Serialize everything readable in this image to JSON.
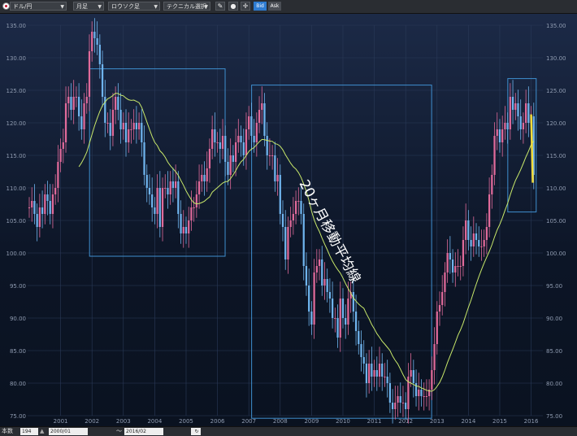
{
  "toolbar": {
    "pair_label": "ドル/円",
    "period_label": "月足",
    "chart_type_label": "ロウソク足",
    "indicator_label": "テクニカル選択",
    "bid_label": "Bid",
    "ask_label": "Ask"
  },
  "bottombar": {
    "count_label": "本数",
    "count_value": "194",
    "start_date": "2000/01",
    "range_sep": "〜",
    "end_date": "2016/02"
  },
  "colors": {
    "up_candle": "#e06a9a",
    "down_candle": "#6fb4ee",
    "ma_line": "#c8e86a",
    "highlight_line": "#f2dc3a",
    "box_border": "#3f8fcf",
    "grid": "#2a3a58"
  },
  "annotation": "20ヶ月移動平均線",
  "chart_data": {
    "type": "candlestick",
    "ylim": [
      75,
      135
    ],
    "yticks": [
      "135.00",
      "130.00",
      "125.00",
      "120.00",
      "115.00",
      "110.00",
      "105.00",
      "100.00",
      "95.00",
      "90.00",
      "85.00",
      "80.00",
      "75.00"
    ],
    "xticks": [
      "2001",
      "2002",
      "2003",
      "2004",
      "2005",
      "2006",
      "2007",
      "2008",
      "2009",
      "2010",
      "2011",
      "2012",
      "2013",
      "2014",
      "2015",
      "2016"
    ],
    "x_start": "2000-01",
    "monthly_close": [
      {
        "year": 2000,
        "close": [
          107,
          108,
          106,
          104,
          107,
          106,
          109,
          108,
          106,
          109,
          110,
          114
        ]
      },
      {
        "year": 2001,
        "close": [
          116,
          117,
          123,
          124,
          122,
          124,
          124,
          121,
          119,
          123,
          124,
          131
        ]
      },
      {
        "year": 2002,
        "close": [
          134,
          133,
          132,
          129,
          124,
          120,
          120,
          118,
          122,
          124,
          122,
          119
        ]
      },
      {
        "year": 2003,
        "close": [
          120,
          117,
          119,
          119,
          120,
          119,
          120,
          117,
          112,
          110,
          109,
          107
        ]
      },
      {
        "year": 2004,
        "close": [
          106,
          110,
          104,
          110,
          110,
          109,
          111,
          110,
          111,
          106,
          103,
          104
        ]
      },
      {
        "year": 2005,
        "close": [
          103,
          105,
          107,
          107,
          109,
          111,
          112,
          111,
          113,
          116,
          119,
          117
        ]
      },
      {
        "year": 2006,
        "close": [
          117,
          116,
          118,
          114,
          112,
          115,
          114,
          117,
          118,
          117,
          115,
          119
        ]
      },
      {
        "year": 2007,
        "close": [
          121,
          118,
          117,
          120,
          122,
          123,
          118,
          115,
          115,
          115,
          111,
          112
        ]
      },
      {
        "year": 2008,
        "close": [
          106,
          104,
          99,
          104,
          105,
          106,
          108,
          108,
          106,
          98,
          95,
          91
        ]
      },
      {
        "year": 2009,
        "close": [
          89,
          97,
          98,
          99,
          95,
          96,
          94,
          93,
          90,
          90,
          87,
          93
        ]
      },
      {
        "year": 2010,
        "close": [
          90,
          89,
          93,
          94,
          91,
          88,
          86,
          84,
          83,
          80,
          83,
          81
        ]
      },
      {
        "year": 2011,
        "close": [
          82,
          81,
          83,
          81,
          81,
          80,
          77,
          76,
          77,
          78,
          77,
          77
        ]
      },
      {
        "year": 2012,
        "close": [
          76,
          81,
          82,
          80,
          78,
          79,
          78,
          78,
          78,
          79,
          82,
          86
        ]
      },
      {
        "year": 2013,
        "close": [
          91,
          92,
          94,
          97,
          100,
          99,
          97,
          98,
          98,
          98,
          102,
          105
        ]
      },
      {
        "year": 2014,
        "close": [
          102,
          101,
          103,
          102,
          101,
          101,
          102,
          104,
          109,
          112,
          118,
          119
        ]
      },
      {
        "year": 2015,
        "close": [
          117,
          119,
          120,
          119,
          124,
          122,
          123,
          121,
          119,
          120,
          123,
          120
        ]
      },
      {
        "year": 2016,
        "close": [
          121,
          112
        ]
      }
    ],
    "ma_period": 20,
    "highlight": "yellow line, 2016/01–2016/02"
  }
}
